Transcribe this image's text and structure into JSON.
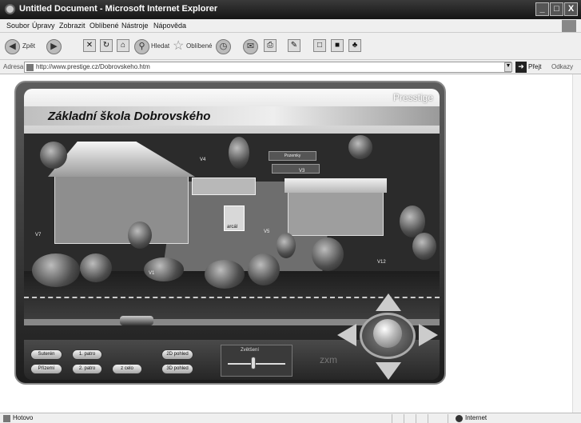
{
  "window": {
    "title": "Untitled Document - Microsoft Internet Explorer",
    "buttons": [
      "_",
      "□",
      "X"
    ]
  },
  "menu": {
    "items": [
      "Soubor",
      "Úpravy",
      "Zobrazit",
      "Oblíbené",
      "Nástroje",
      "Nápověda"
    ]
  },
  "toolbar": {
    "back_label": "Zpět",
    "search_label": "Hledat",
    "favorites_label": "Oblíbené"
  },
  "address": {
    "label": "Adresa",
    "url": "http://www.prestige.cz/Dobrovskeho.htm",
    "go_label": "Přejt",
    "links_label": "Odkazy"
  },
  "app": {
    "title": "Základní škola Dobrovského",
    "brand": "Presstige",
    "map_labels": {
      "v1": "V1",
      "v3": "V3",
      "v4": "V4",
      "v5": "V5",
      "v7": "V7",
      "v12": "V12",
      "sign1": "Pozemky",
      "annex": "arcál"
    },
    "buttons": {
      "suterén": "Suterén",
      "floor1": "1. patro",
      "ground": "Přízemí",
      "floor2": "2. patro",
      "all": "z celo",
      "view2d": "2D pohled",
      "view3d": "3D pohled"
    },
    "zoom_label": "Zvětšení",
    "zoom_word": "zxm",
    "zoom_level": 0.45
  },
  "status": {
    "text": "Hotovo",
    "zone": "Internet"
  }
}
